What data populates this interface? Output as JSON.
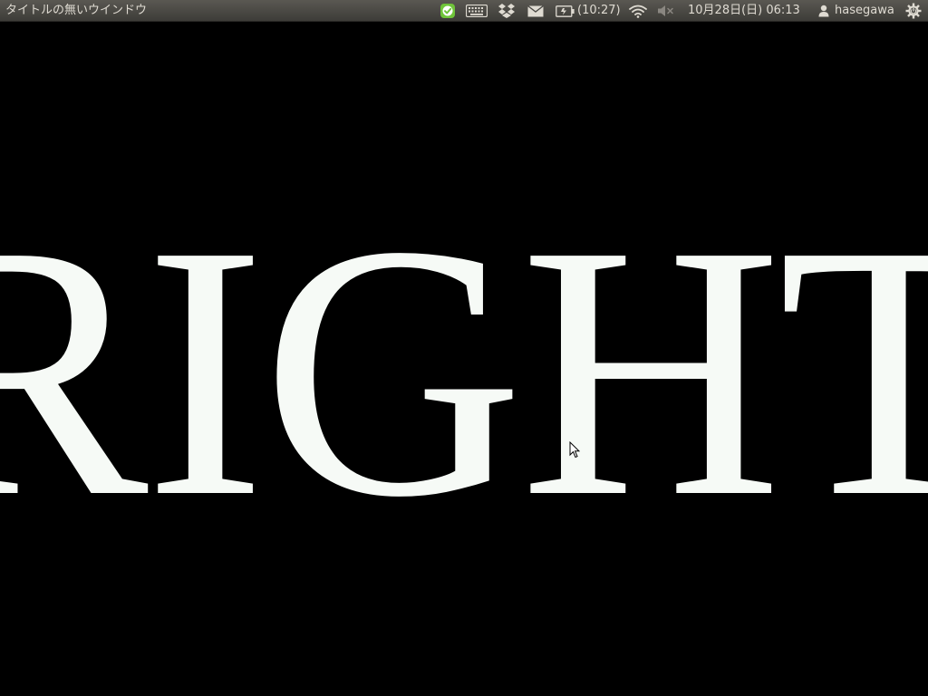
{
  "top_panel": {
    "window_title": "タイトルの無いウインドウ",
    "indicators": [
      {
        "name": "checkmark-status-icon",
        "color": "#6fc43a"
      },
      {
        "name": "keyboard-icon"
      },
      {
        "name": "dropbox-icon"
      },
      {
        "name": "mail-icon"
      },
      {
        "name": "battery-icon"
      },
      {
        "name": "wifi-icon"
      },
      {
        "name": "volume-muted-icon"
      },
      {
        "name": "user-icon"
      },
      {
        "name": "power-gear-icon"
      }
    ],
    "battery_time": "(10:27)",
    "clock": "10月28日(日) 06:13",
    "username": "hasegawa"
  },
  "content": {
    "text": "RIGHT",
    "background": "#000000",
    "text_color": "#f6faf6"
  }
}
